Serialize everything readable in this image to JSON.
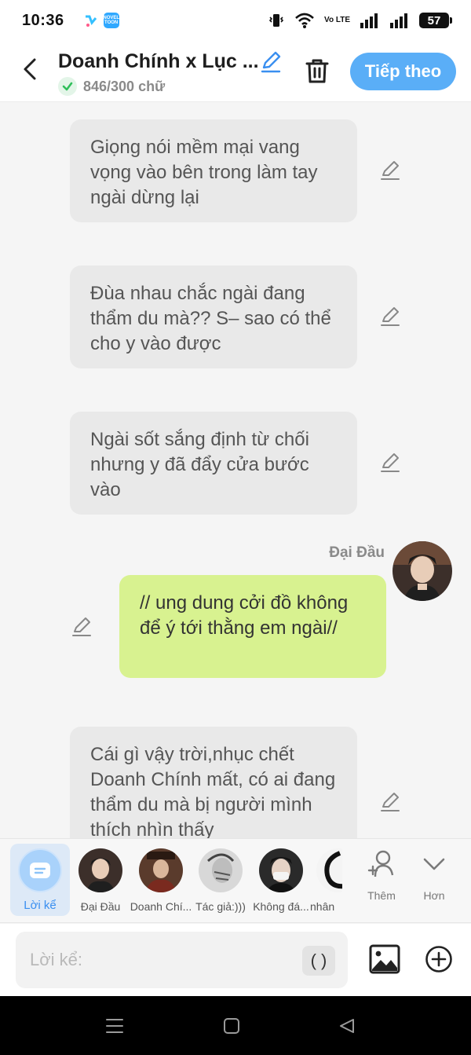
{
  "status_bar": {
    "time": "10:36",
    "app_badges": [
      "NOVEL TOON"
    ],
    "network_label": "Vo LTE",
    "battery": "57"
  },
  "header": {
    "title": "Doanh Chính x Lục ...",
    "word_count": "846/300 chữ",
    "next_button": "Tiếp theo"
  },
  "messages": [
    {
      "type": "narration",
      "text": "Giọng nói mềm mại vang vọng vào bên trong làm tay ngài dừng lại"
    },
    {
      "type": "narration",
      "text": "Đùa nhau chắc ngài đang thẩm du mà?? S– sao có thể cho y vào được"
    },
    {
      "type": "narration",
      "text": "Ngài sốt sắng định từ chối nhưng y đã đẩy cửa bước vào"
    },
    {
      "type": "self",
      "sender": "Đại Đầu",
      "text": "// ung dung cởi đồ không để ý tới thằng em ngài//"
    },
    {
      "type": "narration",
      "text": "Cái gì vậy trời,nhục chết Doanh Chính mất, có ai đang thẩm du mà bị người mình thích nhìn thấy"
    }
  ],
  "characters": {
    "narrator_label": "Lời kể",
    "items": [
      {
        "label": "Đại Đầu"
      },
      {
        "label": "Doanh Chí..."
      },
      {
        "label": "Tác giả:)))"
      },
      {
        "label": "Không đá..."
      },
      {
        "label": "nhân"
      }
    ],
    "add_label": "Thêm",
    "more_label": "Hơn"
  },
  "composer": {
    "placeholder": "Lời kể:",
    "paren_button": "( )"
  },
  "colors": {
    "accent_blue": "#5aaef7",
    "self_bubble": "#d8f290",
    "narration_bubble": "#e9e9e9",
    "background": "#f5f5f5"
  },
  "icons": [
    "back-arrow-icon",
    "pencil-icon",
    "trash-icon",
    "check-icon",
    "document-icon",
    "add-person-icon",
    "chevron-down-icon",
    "image-icon",
    "plus-circle-icon",
    "menu-icon",
    "home-icon",
    "back-triangle-icon",
    "wifi-icon",
    "signal-icon",
    "vibrate-icon"
  ]
}
